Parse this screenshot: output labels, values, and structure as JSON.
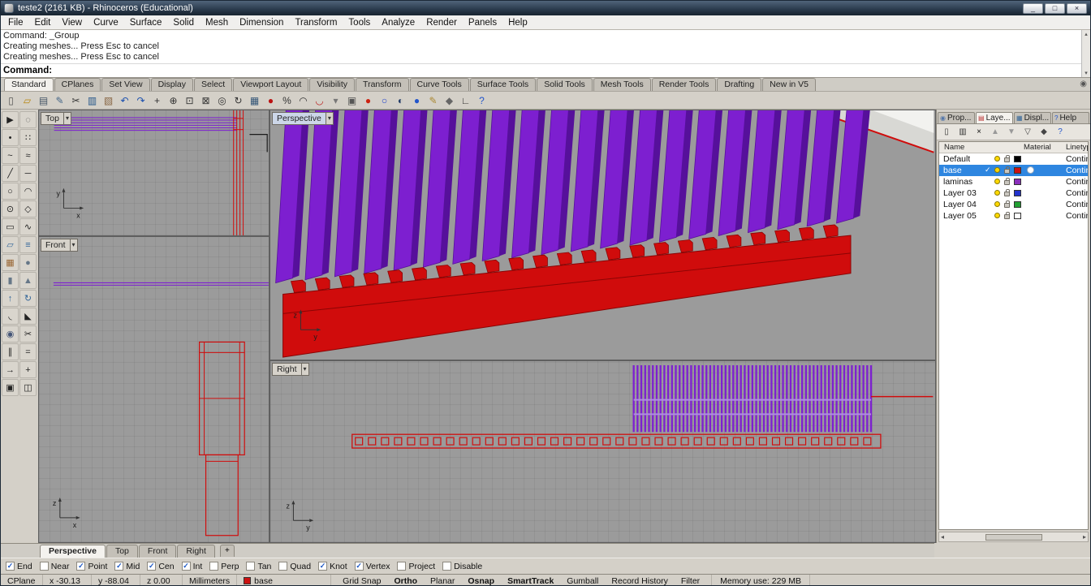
{
  "window": {
    "title": "teste2 (2161 KB) - Rhinoceros (Educational)",
    "minimize_glyph": "_",
    "maximize_glyph": "□",
    "close_glyph": "×"
  },
  "ui": {
    "check": "✓",
    "dropdown": "▾",
    "arrow_up": "▴",
    "arrow_down": "▾",
    "arrow_left": "◂",
    "arrow_right": "▸",
    "options": "◉",
    "grip": "+"
  },
  "menu": {
    "items": [
      "File",
      "Edit",
      "View",
      "Curve",
      "Surface",
      "Solid",
      "Mesh",
      "Dimension",
      "Transform",
      "Tools",
      "Analyze",
      "Render",
      "Panels",
      "Help"
    ]
  },
  "command": {
    "history": [
      "Command: _Group",
      "Creating meshes... Press Esc to cancel",
      "Creating meshes... Press Esc to cancel"
    ],
    "prompt": "Command:"
  },
  "toolbar_tabs": {
    "items": [
      {
        "label": "Standard",
        "active": true
      },
      {
        "label": "CPlanes"
      },
      {
        "label": "Set View"
      },
      {
        "label": "Display"
      },
      {
        "label": "Select"
      },
      {
        "label": "Viewport Layout"
      },
      {
        "label": "Visibility"
      },
      {
        "label": "Transform"
      },
      {
        "label": "Curve Tools"
      },
      {
        "label": "Surface Tools"
      },
      {
        "label": "Solid Tools"
      },
      {
        "label": "Mesh Tools"
      },
      {
        "label": "Render Tools"
      },
      {
        "label": "Drafting"
      },
      {
        "label": "New in V5"
      }
    ]
  },
  "toolbar_icons": [
    {
      "name": "new-file",
      "glyph": "▯",
      "color": "#555555"
    },
    {
      "name": "open-file",
      "glyph": "▱",
      "color": "#b8860b"
    },
    {
      "name": "print",
      "glyph": "▤",
      "color": "#445566"
    },
    {
      "name": "edit-page",
      "glyph": "✎",
      "color": "#446688"
    },
    {
      "name": "cut",
      "glyph": "✂",
      "color": "#333333"
    },
    {
      "name": "copy-to-clipboard",
      "glyph": "▥",
      "color": "#225588"
    },
    {
      "name": "paste-from-clipboard",
      "glyph": "▧",
      "color": "#886644"
    },
    {
      "name": "undo",
      "glyph": "↶",
      "color": "#1a4fae"
    },
    {
      "name": "redo",
      "glyph": "↷",
      "color": "#1a4fae"
    },
    {
      "name": "pan-view",
      "glyph": "+",
      "color": "#333333"
    },
    {
      "name": "zoom-dynamic",
      "glyph": "⊕",
      "color": "#333333"
    },
    {
      "name": "zoom-window",
      "glyph": "⊡",
      "color": "#333333"
    },
    {
      "name": "zoom-extents",
      "glyph": "⊠",
      "color": "#333333"
    },
    {
      "name": "zoom-selected",
      "glyph": "◎",
      "color": "#333333"
    },
    {
      "name": "rotate-view",
      "glyph": "↻",
      "color": "#333333"
    },
    {
      "name": "viewport-layout",
      "glyph": "▦",
      "color": "#335577"
    },
    {
      "name": "shade-seal",
      "glyph": "●",
      "color": "#bb1111"
    },
    {
      "name": "percent-scale",
      "glyph": "%",
      "color": "#333333"
    },
    {
      "name": "arc-tool",
      "glyph": "◠",
      "color": "#333333"
    },
    {
      "name": "magnet-snap",
      "glyph": "◡",
      "color": "#bb2222"
    },
    {
      "name": "pushpin",
      "glyph": "▾",
      "color": "#777777"
    },
    {
      "name": "lock-objects",
      "glyph": "▣",
      "color": "#555555"
    },
    {
      "name": "render-sphere",
      "glyph": "●",
      "color": "#cc2211"
    },
    {
      "name": "circle-tool",
      "glyph": "○",
      "color": "#2244cc"
    },
    {
      "name": "shaded-globe",
      "glyph": "◐",
      "color": "#223a66"
    },
    {
      "name": "earth-globe",
      "glyph": "●",
      "color": "#2255cc"
    },
    {
      "name": "notes",
      "glyph": "✎",
      "color": "#aa8833"
    },
    {
      "name": "options-gear",
      "glyph": "◆",
      "color": "#666666"
    },
    {
      "name": "cplane-axis",
      "glyph": "∟",
      "color": "#333333"
    },
    {
      "name": "help",
      "glyph": "?",
      "color": "#2255cc"
    }
  ],
  "sidebar_icons": [
    {
      "name": "select-pointer",
      "glyph": "▶",
      "color": "#222222"
    },
    {
      "name": "lasso-select",
      "glyph": "◌",
      "color": "#444444"
    },
    {
      "name": "point",
      "glyph": "•",
      "color": "#222222"
    },
    {
      "name": "point-cloud",
      "glyph": "∷",
      "color": "#222222"
    },
    {
      "name": "curve",
      "glyph": "~",
      "color": "#222222"
    },
    {
      "name": "control-point-curve",
      "glyph": "≈",
      "color": "#222222"
    },
    {
      "name": "polyline",
      "glyph": "╱",
      "color": "#222222"
    },
    {
      "name": "line",
      "glyph": "─",
      "color": "#222222"
    },
    {
      "name": "circle",
      "glyph": "○",
      "color": "#222222"
    },
    {
      "name": "arc",
      "glyph": "◠",
      "color": "#222222"
    },
    {
      "name": "ellipse",
      "glyph": "⊙",
      "color": "#222222"
    },
    {
      "name": "polygon",
      "glyph": "◇",
      "color": "#222222"
    },
    {
      "name": "rectangle",
      "glyph": "▭",
      "color": "#222222"
    },
    {
      "name": "helix",
      "glyph": "∿",
      "color": "#222222"
    },
    {
      "name": "surface-plane",
      "glyph": "▱",
      "color": "#336699"
    },
    {
      "name": "loft-surface",
      "glyph": "≡",
      "color": "#336699"
    },
    {
      "name": "box",
      "glyph": "▦",
      "color": "#996633"
    },
    {
      "name": "sphere",
      "glyph": "●",
      "color": "#667788"
    },
    {
      "name": "cylinder",
      "glyph": "▮",
      "color": "#667788"
    },
    {
      "name": "cone",
      "glyph": "▲",
      "color": "#667788"
    },
    {
      "name": "extrude-curve",
      "glyph": "↑",
      "color": "#336699"
    },
    {
      "name": "revolve",
      "glyph": "↻",
      "color": "#336699"
    },
    {
      "name": "fillet-curve",
      "glyph": "◟",
      "color": "#222222"
    },
    {
      "name": "chamfer-curve",
      "glyph": "◣",
      "color": "#222222"
    },
    {
      "name": "boolean-union",
      "glyph": "◉",
      "color": "#445577"
    },
    {
      "name": "trim",
      "glyph": "✂",
      "color": "#222222"
    },
    {
      "name": "split",
      "glyph": "∥",
      "color": "#222222"
    },
    {
      "name": "offset-curve",
      "glyph": "=",
      "color": "#222222"
    },
    {
      "name": "extend-curve",
      "glyph": "→",
      "color": "#222222"
    },
    {
      "name": "move",
      "glyph": "+",
      "color": "#222222"
    },
    {
      "name": "copy-object",
      "glyph": "▣",
      "color": "#222222"
    },
    {
      "name": "mirror",
      "glyph": "◫",
      "color": "#222222"
    }
  ],
  "viewports": {
    "top": {
      "label": "Top"
    },
    "front": {
      "label": "Front"
    },
    "perspective": {
      "label": "Perspective"
    },
    "right": {
      "label": "Right"
    }
  },
  "viewport_tabs": {
    "items": [
      {
        "label": "Perspective",
        "active": true
      },
      {
        "label": "Top"
      },
      {
        "label": "Front"
      },
      {
        "label": "Right"
      }
    ]
  },
  "panel": {
    "tabs": [
      {
        "label": "Prop...",
        "glyph": "◉",
        "color": "#5577aa"
      },
      {
        "label": "Laye...",
        "glyph": "▤",
        "color": "#bb3333",
        "active": true
      },
      {
        "label": "Displ...",
        "glyph": "▦",
        "color": "#336699"
      },
      {
        "label": "Help",
        "glyph": "?",
        "color": "#2255cc"
      }
    ],
    "toolbar_icons": [
      {
        "name": "new-layer",
        "glyph": "▯",
        "color": "#333333"
      },
      {
        "name": "duplicate-layer",
        "glyph": "▥",
        "color": "#333333"
      },
      {
        "name": "delete-layer",
        "glyph": "×",
        "color": "#111111"
      },
      {
        "name": "move-layer-up",
        "glyph": "▲",
        "color": "#999999"
      },
      {
        "name": "move-layer-down",
        "glyph": "▼",
        "color": "#999999"
      },
      {
        "name": "filter-layers",
        "glyph": "▽",
        "color": "#444444"
      },
      {
        "name": "layer-tools",
        "glyph": "◆",
        "color": "#444444"
      },
      {
        "name": "layer-help",
        "glyph": "?",
        "color": "#2255cc"
      }
    ],
    "columns": [
      "Name",
      "Material",
      "Linetype"
    ],
    "layers": [
      {
        "name": "Default",
        "color": "#000000",
        "linetype": "Continuous"
      },
      {
        "name": "base",
        "color": "#cc1111",
        "linetype": "Continuous",
        "selected": true,
        "current": true,
        "material": true
      },
      {
        "name": "laminas",
        "color": "#8a2fbb",
        "linetype": "Continuous"
      },
      {
        "name": "Layer 03",
        "color": "#2233cc",
        "linetype": "Continuous"
      },
      {
        "name": "Layer 04",
        "color": "#22a033",
        "linetype": "Continuous"
      },
      {
        "name": "Layer 05",
        "color": "#ffffff",
        "linetype": "Continuous"
      }
    ]
  },
  "osnap": {
    "items": [
      {
        "label": "End",
        "checked": true
      },
      {
        "label": "Near",
        "checked": false
      },
      {
        "label": "Point",
        "checked": true
      },
      {
        "label": "Mid",
        "checked": true
      },
      {
        "label": "Cen",
        "checked": true
      },
      {
        "label": "Int",
        "checked": true
      },
      {
        "label": "Perp",
        "checked": false
      },
      {
        "label": "Tan",
        "checked": false
      },
      {
        "label": "Quad",
        "checked": false
      },
      {
        "label": "Knot",
        "checked": true
      },
      {
        "label": "Vertex",
        "checked": true
      },
      {
        "label": "Project",
        "checked": false
      },
      {
        "label": "Disable",
        "checked": false
      }
    ]
  },
  "status": {
    "cplane": "CPlane",
    "x": "x -30.13",
    "y": "y -88.04",
    "z": "z 0.00",
    "units": "Millimeters",
    "layer": "base",
    "layer_color": "#cc1111",
    "toggles": [
      {
        "label": "Grid Snap"
      },
      {
        "label": "Ortho",
        "bold": true
      },
      {
        "label": "Planar"
      },
      {
        "label": "Osnap",
        "bold": true
      },
      {
        "label": "SmartTrack",
        "bold": true
      },
      {
        "label": "Gumball"
      },
      {
        "label": "Record History"
      },
      {
        "label": "Filter"
      }
    ],
    "memory": "Memory use: 229 MB"
  },
  "scene": {
    "viewport_bg": "#9b9b9b",
    "purple": "#7d1fd0",
    "purple_dark": "#56109b",
    "purple_light": "#b18ae6",
    "red": "#d00c0c",
    "red_dark": "#8a0404",
    "white_corner": "#f2f2ef",
    "light_corner": "#d8d8d4",
    "slat_count": 20,
    "teeth_count": 23,
    "stripe_count": 62,
    "square_count": 40,
    "axes": {
      "top": {
        "v": "y",
        "h": "x"
      },
      "front": {
        "v": "z",
        "h": "x"
      },
      "perspective": {
        "v": "z",
        "h": "y"
      },
      "right": {
        "v": "z",
        "h": "y"
      }
    }
  }
}
